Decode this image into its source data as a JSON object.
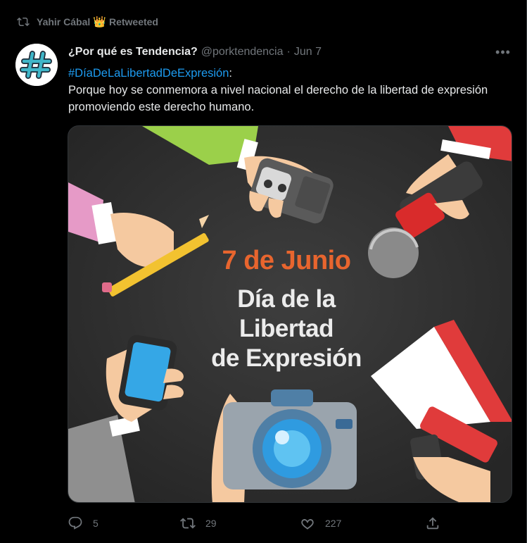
{
  "retweet_context": {
    "user": "Yahir Cábal",
    "badge": "👑",
    "label": "Retweeted"
  },
  "author": {
    "name": "¿Por qué es Tendencia?",
    "handle": "@porktendencia",
    "separator": "·",
    "date": "Jun 7",
    "avatar_glyph": "#"
  },
  "tweet": {
    "hashtag": "#DíaDeLaLibertadDeExpresión",
    "hashtag_suffix": ":",
    "text": "Porque hoy se conmemora a nivel nacional el derecho de la libertad de expresión promoviendo este derecho humano."
  },
  "media": {
    "date_text": "7 de Junio",
    "line1": "Día de la",
    "line2": "Libertad",
    "line3": "de Expresión"
  },
  "actions": {
    "reply_count": "5",
    "retweet_count": "29",
    "like_count": "227"
  },
  "more_label": "•••",
  "colors": {
    "background": "#000000",
    "text": "#e7e9ea",
    "muted": "#71767b",
    "accent": "#1d9bf0",
    "poster_date": "#e8652e",
    "poster_bg": "#2e2e2e"
  }
}
